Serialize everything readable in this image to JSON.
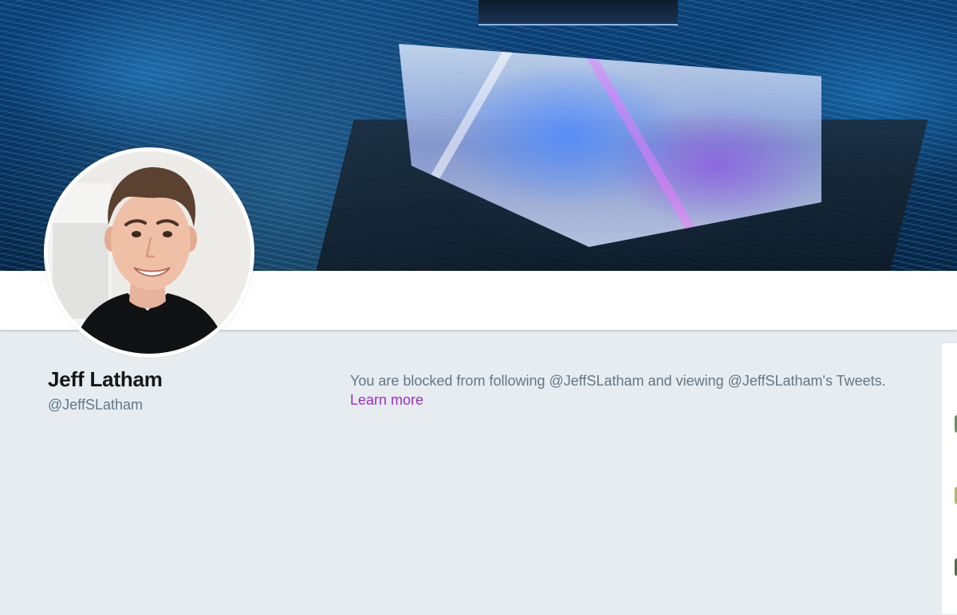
{
  "profile": {
    "name": "Jeff Latham",
    "handle": "@JeffSLatham"
  },
  "blocked_notice": {
    "message": "You are blocked from following @JeffSLatham and viewing @JeffSLatham's Tweets. ",
    "link_label": "Learn more"
  },
  "colors": {
    "page_background": "#e6ecf0",
    "name_text": "#14171a",
    "secondary_text": "#657786",
    "link": "#9a2fc4"
  }
}
